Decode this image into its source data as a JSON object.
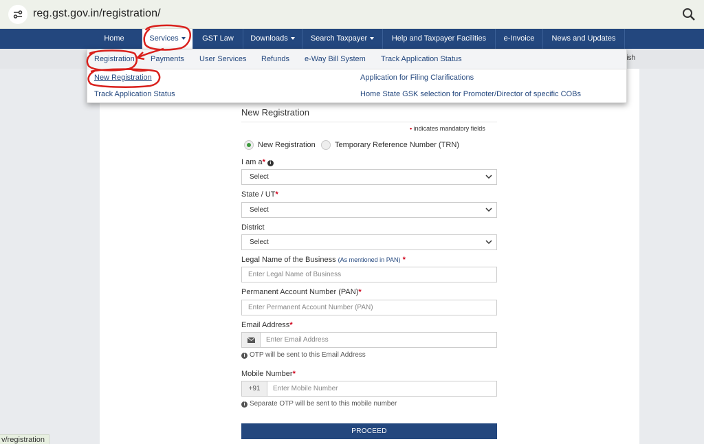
{
  "browser": {
    "url": "reg.gst.gov.in/registration/",
    "status_url": "v/registration"
  },
  "nav": {
    "items": [
      {
        "label": "Home"
      },
      {
        "label": "Services",
        "caret": true
      },
      {
        "label": "GST Law"
      },
      {
        "label": "Downloads",
        "caret": true
      },
      {
        "label": "Search Taxpayer",
        "caret": true
      },
      {
        "label": "Help and Taxpayer Facilities"
      },
      {
        "label": "e-Invoice"
      },
      {
        "label": "News and Updates"
      }
    ],
    "active": "Services"
  },
  "language_partial": "lish",
  "services_menu": {
    "tabs": [
      "Registration",
      "Payments",
      "User Services",
      "Refunds",
      "e-Way Bill System",
      "Track Application Status"
    ],
    "links": {
      "new_registration": "New Registration",
      "track_status": "Track Application Status",
      "filing_clarifications": "Application for Filing Clarifications",
      "home_state_gsk": "Home State GSK selection for Promoter/Director of specific COBs"
    }
  },
  "form": {
    "title": "New Registration",
    "mandatory_note": "indicates mandatory fields",
    "radio": {
      "new_registration": "New Registration",
      "trn": "Temporary Reference Number (TRN)",
      "selected": "new_registration"
    },
    "i_am_a": {
      "label": "I am a",
      "value": "Select"
    },
    "state": {
      "label": "State / UT",
      "value": "Select"
    },
    "district": {
      "label": "District",
      "value": "Select"
    },
    "legal_name": {
      "label": "Legal Name of the Business",
      "hint": "(As mentioned in PAN)",
      "placeholder": "Enter Legal Name of Business"
    },
    "pan": {
      "label": "Permanent Account Number (PAN)",
      "placeholder": "Enter Permanent Account Number (PAN)"
    },
    "email": {
      "label": "Email Address",
      "placeholder": "Enter Email Address",
      "help": "OTP will be sent to this Email Address"
    },
    "mobile": {
      "label": "Mobile Number",
      "prefix": "+91",
      "placeholder": "Enter Mobile Number",
      "help": "Separate OTP will be sent to this mobile number"
    },
    "proceed_label": "PROCEED"
  },
  "colors": {
    "nav_bg": "#23477e",
    "link": "#23477e",
    "mandatory_star": "#d0021b",
    "radio_checked": "#3c9a3c",
    "annotation": "#d9201c"
  }
}
